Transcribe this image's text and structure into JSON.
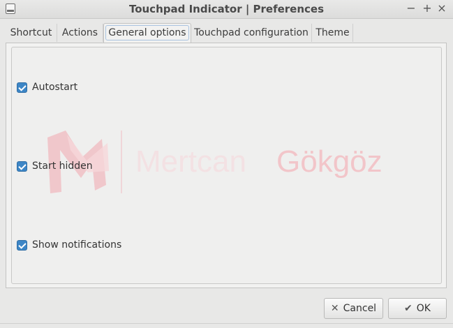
{
  "window": {
    "title": "Touchpad Indicator | Preferences",
    "minimize_icon": "minimize-icon",
    "maximize_icon": "maximize-icon",
    "close_icon": "close-icon",
    "minimize_glyph": "−",
    "maximize_glyph": "+",
    "close_glyph": "×"
  },
  "tabs": [
    {
      "label": "Shortcut"
    },
    {
      "label": "Actions"
    },
    {
      "label": "General options"
    },
    {
      "label": "Touchpad configuration"
    },
    {
      "label": "Theme"
    }
  ],
  "active_tab": "General options",
  "options": [
    {
      "label": "Autostart",
      "checked": true
    },
    {
      "label": "Start hidden",
      "checked": true
    },
    {
      "label": "Show notifications",
      "checked": true
    }
  ],
  "watermark": {
    "text_light": "Mertcan",
    "text_strong": "Gökgöz",
    "color": "#f2c5c9"
  },
  "buttons": {
    "cancel_label": "Cancel",
    "cancel_glyph": "✕",
    "ok_label": "OK",
    "ok_glyph": "✔"
  },
  "colors": {
    "checkbox_accent": "#3d86c6"
  }
}
